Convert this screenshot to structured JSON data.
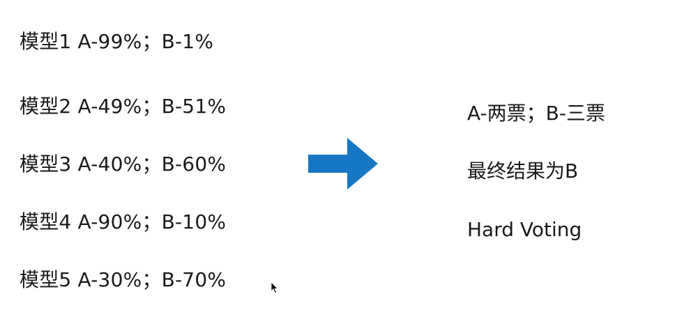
{
  "models": [
    {
      "label": "模型1 A-99%；B-1%"
    },
    {
      "label": "模型2 A-49%；B-51%"
    },
    {
      "label": "模型3 A-40%；B-60%"
    },
    {
      "label": "模型4 A-90%；B-10%"
    },
    {
      "label": "模型5 A-30%；B-70%"
    }
  ],
  "arrow": {
    "icon": "right-arrow-icon",
    "color": "#1677c4"
  },
  "results": {
    "votes": "A-两票；B-三票",
    "final": "最终结果为B",
    "method": "Hard Voting"
  },
  "cursor": {
    "icon": "mouse-cursor-icon"
  }
}
